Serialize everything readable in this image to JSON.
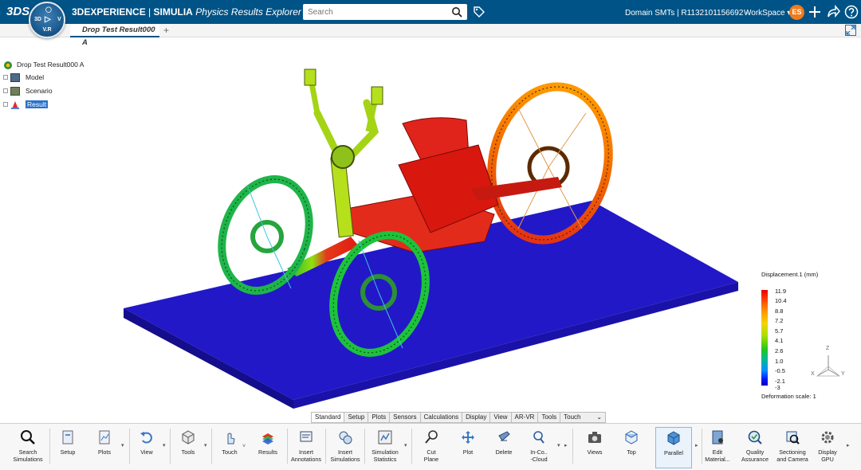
{
  "header": {
    "logo": "3DS",
    "compass_label": "V.R",
    "compass_quadrants": [
      "3D",
      "i",
      "V"
    ],
    "brand_bold": "3DEXPERIENCE",
    "brand_mid": "SIMULIA",
    "app_name": "Physics Results Explorer",
    "search_placeholder": "Search",
    "domain": "Domain SMTs | R1132101156692 -",
    "workspace": "WorkSpace",
    "avatar_initials": "ES"
  },
  "tabs": [
    {
      "label": "Drop Test Result000 A"
    }
  ],
  "tree": {
    "root": "Drop Test Result000 A",
    "children": [
      "Model",
      "Scenario",
      "Result"
    ]
  },
  "legend": {
    "title": "Displacement.1 (mm)",
    "ticks": [
      "11.9",
      "10.4",
      "8.8",
      "7.2",
      "5.7",
      "4.1",
      "2.6",
      "1.0",
      "-0.5",
      "-2.1",
      "-3"
    ],
    "deformation": "Deformation scale: 1"
  },
  "triad": {
    "z": "Z",
    "x": "X",
    "y": "Y"
  },
  "toolbar_tabs": [
    "Standard",
    "Setup",
    "Plots",
    "Sensors",
    "Calculations",
    "Display",
    "View",
    "AR-VR",
    "Tools",
    "Touch"
  ],
  "ribbon": [
    {
      "label": "Search\nSimulations",
      "icon": "search-icon"
    },
    {
      "label": "Setup",
      "icon": "setup-icon"
    },
    {
      "label": "Plots",
      "icon": "plots-icon"
    },
    {
      "label": "View",
      "icon": "undo-view-icon"
    },
    {
      "label": "Tools",
      "icon": "cube-tools-icon"
    },
    {
      "label": "Touch",
      "icon": "touch-icon"
    },
    {
      "label": "Results",
      "icon": "results-icon"
    },
    {
      "label": "Insert\nAnnotations",
      "icon": "annotation-icon"
    },
    {
      "label": "Insert\nSimulations",
      "icon": "insert-simulations-icon"
    },
    {
      "label": "Simulation\nStatistics",
      "icon": "statistics-icon"
    },
    {
      "label": "Cut\nPlane",
      "icon": "cut-plane-icon"
    },
    {
      "label": "Plot",
      "icon": "plot-move-icon"
    },
    {
      "label": "Delete",
      "icon": "delete-icon"
    },
    {
      "label": "In-Co..\n-Cloud",
      "icon": "cloud-search-icon"
    },
    {
      "label": "Views",
      "icon": "camera-icon"
    },
    {
      "label": "Top",
      "icon": "top-view-icon"
    },
    {
      "label": "Parallel",
      "icon": "parallel-icon"
    },
    {
      "label": "Edit\nMaterial...",
      "icon": "edit-material-icon"
    },
    {
      "label": "Quality\nAssurance",
      "icon": "quality-icon"
    },
    {
      "label": "Sectioning\nand Camera",
      "icon": "sectioning-icon"
    },
    {
      "label": "Display\nGPU",
      "icon": "gear-icon"
    }
  ]
}
